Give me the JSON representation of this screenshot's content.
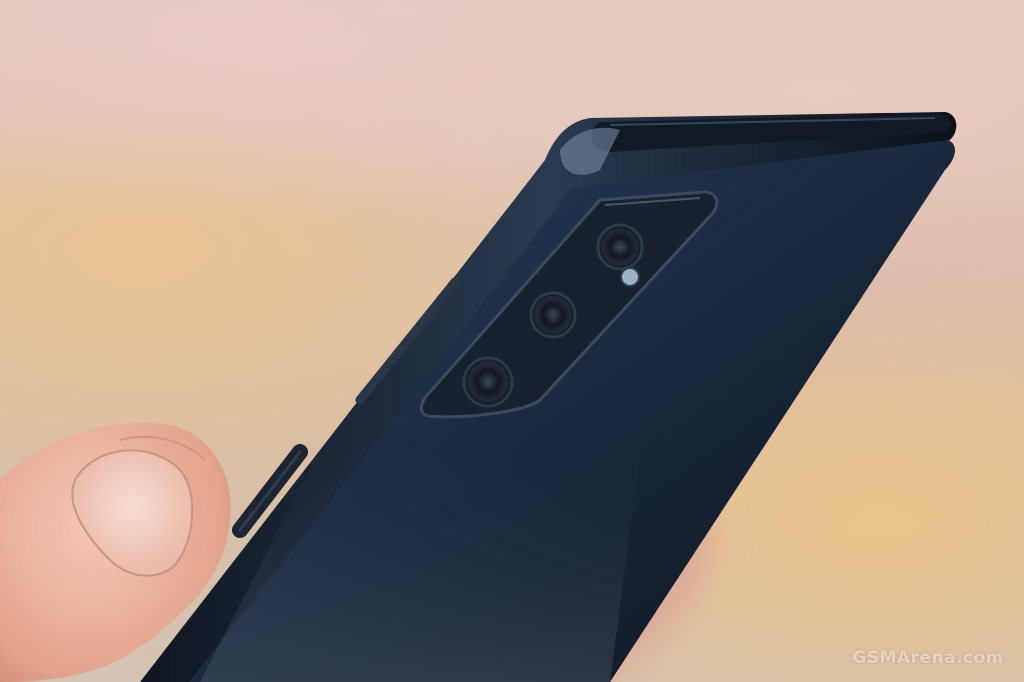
{
  "photo": {
    "subject": "hand-holding-smartphone-back",
    "background_colors": [
      "#e3c7c0",
      "#e8c596",
      "#d9beb2"
    ],
    "phone_color": "#1d2a3c",
    "skin_color": "#e9b7a2"
  },
  "watermark": {
    "text": "GSMArena.com"
  }
}
